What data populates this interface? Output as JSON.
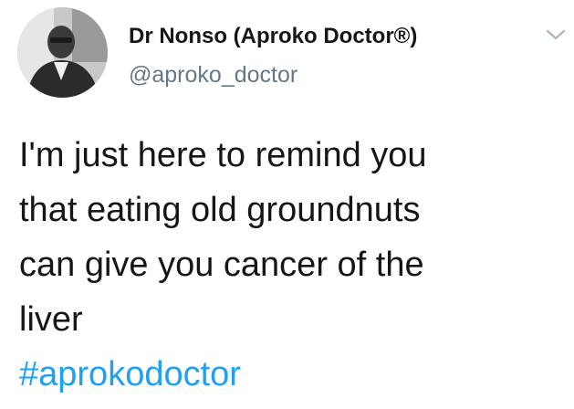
{
  "tweet": {
    "author": {
      "display_name": "Dr Nonso (Aproko Doctor®)",
      "handle": "@aproko_doctor"
    },
    "text_lines": [
      "I'm just here to remind you",
      "that eating old groundnuts",
      "can give you cancer of the",
      "liver"
    ],
    "hashtag": "#aprokodoctor",
    "icons": {
      "menu": "chevron-down-icon",
      "avatar": "profile-photo"
    },
    "colors": {
      "text": "#14171a",
      "handle": "#657786",
      "link": "#1da1f2",
      "chevron": "#aab8c2"
    }
  }
}
